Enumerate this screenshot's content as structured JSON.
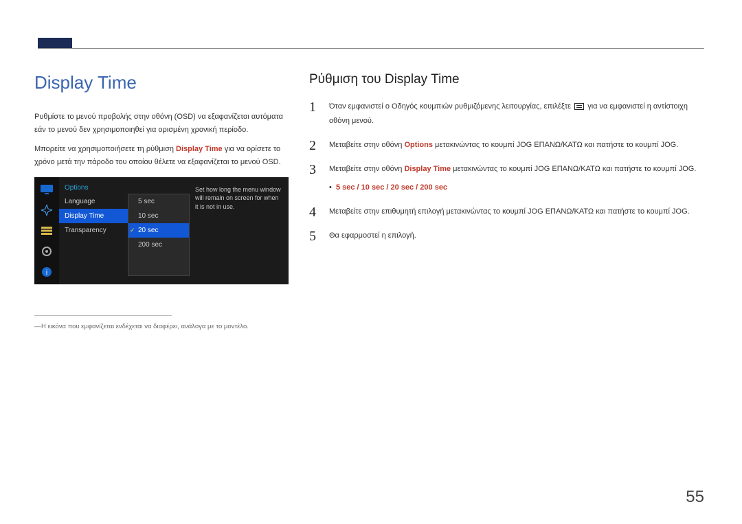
{
  "page_number": "55",
  "left": {
    "title": "Display Time",
    "para1": "Ρυθμίστε το μενού προβολής στην οθόνη (OSD) να εξαφανίζεται αυτόματα εάν το μενού δεν χρησιμοποιηθεί για ορισμένη χρονική περίοδο.",
    "para2_a": "Μπορείτε να χρησιμοποιήσετε τη ρύθμιση ",
    "para2_accent": "Display Time",
    "para2_b": " για να ορίσετε το χρόνο μετά την πάροδο του οποίου θέλετε να εξαφανίζεται το μενού OSD.",
    "osd": {
      "header": "Options",
      "items": [
        "Language",
        "Display Time",
        "Transparency"
      ],
      "selected_index": 1,
      "sub_items": [
        "5 sec",
        "10 sec",
        "20 sec",
        "200 sec"
      ],
      "sub_selected_index": 2,
      "desc": "Set how long the menu window will remain on screen for when it is not in use."
    },
    "footnote": "Η εικόνα που εμφανίζεται ενδέχεται να διαφέρει, ανάλογα με το μοντέλο."
  },
  "right": {
    "title": "Ρύθμιση του Display Time",
    "steps": {
      "1": {
        "a": "Όταν εμφανιστεί ο Οδηγός κουμπιών ρυθμιζόμενης λειτουργίας, επιλέξτε ",
        "b": " για να εμφανιστεί η αντίστοιχη οθόνη μενού."
      },
      "2": {
        "a": "Μεταβείτε στην οθόνη ",
        "accent": "Options",
        "b": " μετακινώντας το κουμπί JOG ΕΠΑΝΩ/ΚΑΤΩ και πατήστε το κουμπί JOG."
      },
      "3": {
        "a": "Μεταβείτε στην οθόνη ",
        "accent": "Display Time",
        "b": " μετακινώντας το κουμπί JOG ΕΠΑΝΩ/ΚΑΤΩ και πατήστε το κουμπί JOG.",
        "bullet": "5 sec / 10 sec / 20 sec / 200 sec"
      },
      "4": "Μεταβείτε στην επιθυμητή επιλογή μετακινώντας το κουμπί JOG ΕΠΑΝΩ/ΚΑΤΩ και πατήστε το κουμπί JOG.",
      "5": "Θα εφαρμοστεί η επιλογή."
    }
  }
}
